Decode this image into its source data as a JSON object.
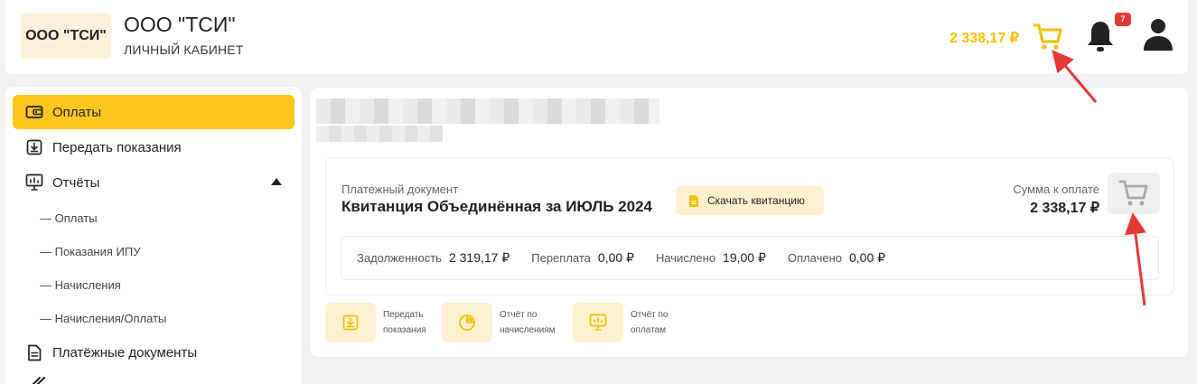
{
  "header": {
    "logo_text": "ООО \"ТСИ\"",
    "org_name": "ООО \"ТСИ\"",
    "org_subtitle": "ЛИЧНЫЙ КАБИНЕТ",
    "cart_amount": "2 338,17 ₽",
    "notifications_count": "7",
    "icons": [
      "cart-icon",
      "bell-icon",
      "user-icon"
    ]
  },
  "sidebar": {
    "items": [
      {
        "label": "Оплаты",
        "icon": "wallet-icon",
        "active": true
      },
      {
        "label": "Передать показания",
        "icon": "download-box-icon"
      },
      {
        "label": "Отчёты",
        "icon": "presentation-icon",
        "expanded": true
      },
      {
        "label": "Платёжные документы",
        "icon": "document-icon"
      }
    ],
    "report_subitems": [
      "— Оплаты",
      "— Показания ИПУ",
      "— Начисления",
      "— Начисления/Оплаты"
    ]
  },
  "payment": {
    "doc_label": "Платежный документ",
    "doc_title": "Квитанция Объединённая за ИЮЛЬ 2024",
    "download_button": "Скачать квитанцию",
    "sum_label": "Сумма к оплате",
    "sum_value": "2 338,17 ₽",
    "summary": [
      {
        "key": "Задолженность",
        "value": "2 319,17 ₽"
      },
      {
        "key": "Переплата",
        "value": "0,00 ₽"
      },
      {
        "key": "Начислено",
        "value": "19,00 ₽"
      },
      {
        "key": "Оплачено",
        "value": "0,00 ₽"
      }
    ]
  },
  "actions": [
    {
      "line1": "Передать",
      "line2": "показания",
      "icon": "download-box-icon"
    },
    {
      "line1": "Отчёт по",
      "line2": "начислениям",
      "icon": "pie-chart-icon"
    },
    {
      "line1": "Отчёт по",
      "line2": "оплатам",
      "icon": "presentation-icon"
    }
  ],
  "colors": {
    "accent": "#fdc71e",
    "accent_light": "#fdf1d0",
    "amount_yellow": "#f5c000",
    "annotation_red": "#e53935"
  }
}
